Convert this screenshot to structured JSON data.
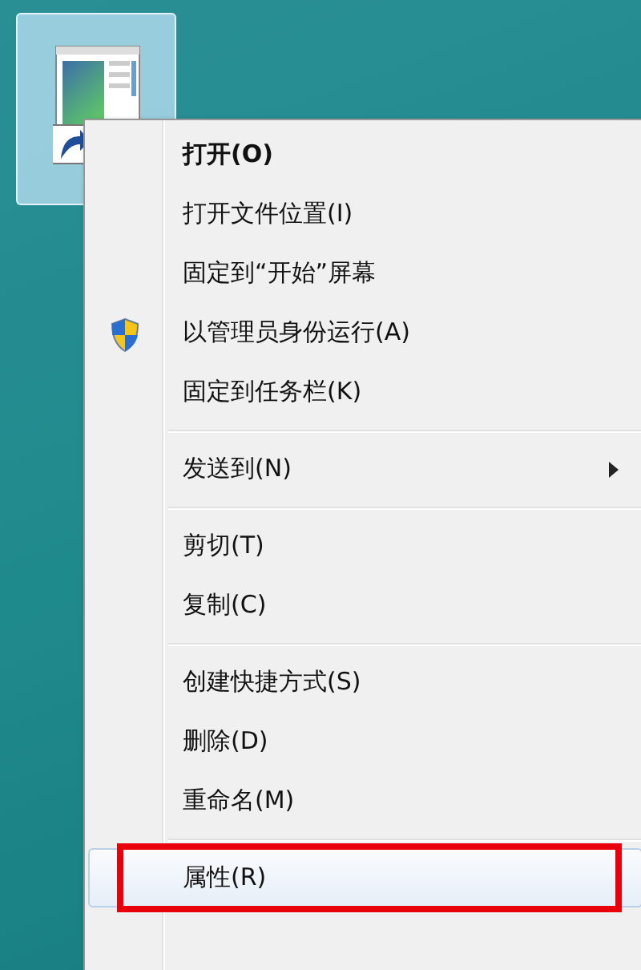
{
  "desktop_icon": {
    "kind": "shortcut",
    "selected": true
  },
  "context_menu": {
    "items": [
      {
        "kind": "item",
        "label": "打开(O)",
        "bold": true,
        "submenu": false,
        "selected": false,
        "outlined": false
      },
      {
        "kind": "item",
        "label": "打开文件位置(I)",
        "bold": false,
        "submenu": false,
        "selected": false,
        "outlined": false
      },
      {
        "kind": "item",
        "label": "固定到“开始”屏幕",
        "bold": false,
        "submenu": false,
        "selected": false,
        "outlined": false
      },
      {
        "kind": "admin_item",
        "label": "以管理员身份运行(A)",
        "bold": false,
        "submenu": false,
        "selected": false,
        "outlined": false
      },
      {
        "kind": "item",
        "label": "固定到任务栏(K)",
        "bold": false,
        "submenu": false,
        "selected": false,
        "outlined": false
      },
      {
        "kind": "separator"
      },
      {
        "kind": "item",
        "label": "发送到(N)",
        "bold": false,
        "submenu": true,
        "selected": false,
        "outlined": false
      },
      {
        "kind": "separator"
      },
      {
        "kind": "item",
        "label": "剪切(T)",
        "bold": false,
        "submenu": false,
        "selected": false,
        "outlined": false
      },
      {
        "kind": "item",
        "label": "复制(C)",
        "bold": false,
        "submenu": false,
        "selected": false,
        "outlined": false
      },
      {
        "kind": "separator"
      },
      {
        "kind": "item",
        "label": "创建快捷方式(S)",
        "bold": false,
        "submenu": false,
        "selected": false,
        "outlined": false
      },
      {
        "kind": "item",
        "label": "删除(D)",
        "bold": false,
        "submenu": false,
        "selected": false,
        "outlined": false
      },
      {
        "kind": "item",
        "label": "重命名(M)",
        "bold": false,
        "submenu": false,
        "selected": false,
        "outlined": false
      },
      {
        "kind": "separator"
      },
      {
        "kind": "item",
        "label": "属性(R)",
        "bold": false,
        "submenu": false,
        "selected": true,
        "outlined": true
      }
    ]
  }
}
